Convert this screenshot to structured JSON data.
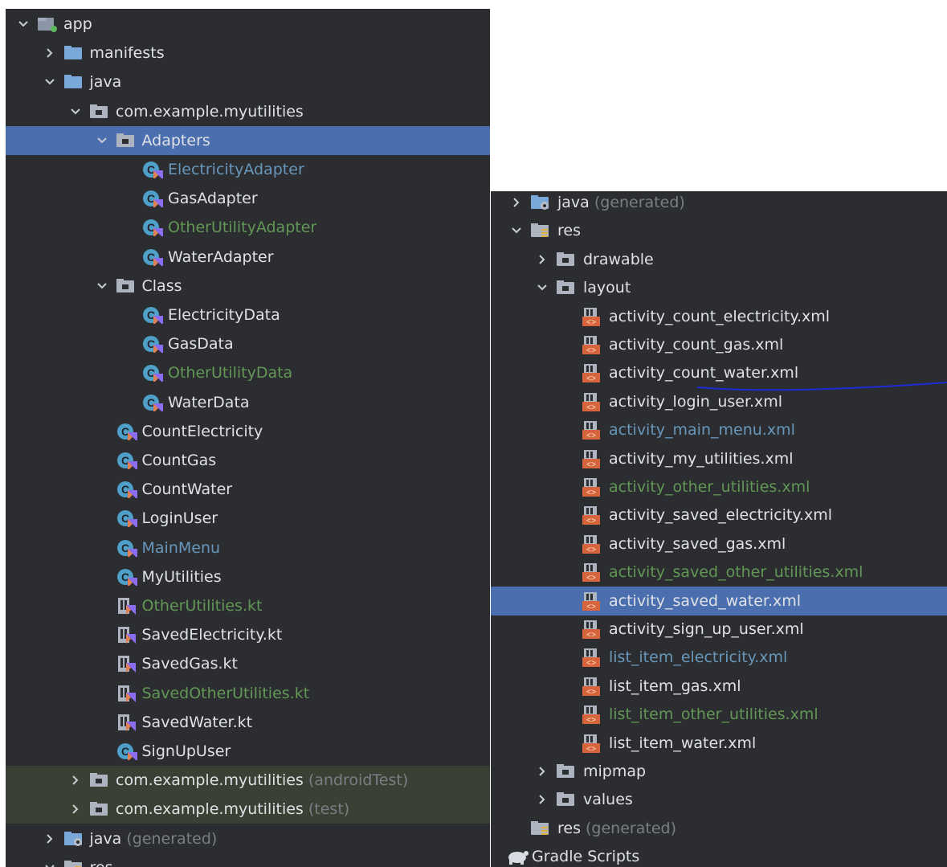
{
  "left_tree": [
    {
      "depth": 0,
      "arrow": "down",
      "icon": "module",
      "label": "app",
      "color": "default"
    },
    {
      "depth": 1,
      "arrow": "right",
      "icon": "folder",
      "label": "manifests",
      "color": "default"
    },
    {
      "depth": 1,
      "arrow": "down",
      "icon": "folder",
      "label": "java",
      "color": "default"
    },
    {
      "depth": 2,
      "arrow": "down",
      "icon": "package",
      "label": "com.example.myutilities",
      "color": "default"
    },
    {
      "depth": 3,
      "arrow": "down",
      "icon": "package",
      "label": "Adapters",
      "color": "default",
      "selected": true
    },
    {
      "depth": 4,
      "icon": "kotlin-class",
      "label": "ElectricityAdapter",
      "color": "blue"
    },
    {
      "depth": 4,
      "icon": "kotlin-class",
      "label": "GasAdapter",
      "color": "default"
    },
    {
      "depth": 4,
      "icon": "kotlin-class",
      "label": "OtherUtilityAdapter",
      "color": "green"
    },
    {
      "depth": 4,
      "icon": "kotlin-class",
      "label": "WaterAdapter",
      "color": "default"
    },
    {
      "depth": 3,
      "arrow": "down",
      "icon": "package",
      "label": "Class",
      "color": "default"
    },
    {
      "depth": 4,
      "icon": "kotlin-class",
      "label": "ElectricityData",
      "color": "default"
    },
    {
      "depth": 4,
      "icon": "kotlin-class",
      "label": "GasData",
      "color": "default"
    },
    {
      "depth": 4,
      "icon": "kotlin-class",
      "label": "OtherUtilityData",
      "color": "green"
    },
    {
      "depth": 4,
      "icon": "kotlin-class",
      "label": "WaterData",
      "color": "default"
    },
    {
      "depth": 3,
      "icon": "kotlin-class",
      "label": "CountElectricity",
      "color": "default"
    },
    {
      "depth": 3,
      "icon": "kotlin-class",
      "label": "CountGas",
      "color": "default"
    },
    {
      "depth": 3,
      "icon": "kotlin-class",
      "label": "CountWater",
      "color": "default"
    },
    {
      "depth": 3,
      "icon": "kotlin-class",
      "label": "LoginUser",
      "color": "default"
    },
    {
      "depth": 3,
      "icon": "kotlin-class",
      "label": "MainMenu",
      "color": "blue"
    },
    {
      "depth": 3,
      "icon": "kotlin-class",
      "label": "MyUtilities",
      "color": "default"
    },
    {
      "depth": 3,
      "icon": "kotlin-file",
      "label": "OtherUtilities.kt",
      "color": "green"
    },
    {
      "depth": 3,
      "icon": "kotlin-file",
      "label": "SavedElectricity.kt",
      "color": "default"
    },
    {
      "depth": 3,
      "icon": "kotlin-file",
      "label": "SavedGas.kt",
      "color": "default"
    },
    {
      "depth": 3,
      "icon": "kotlin-file",
      "label": "SavedOtherUtilities.kt",
      "color": "green"
    },
    {
      "depth": 3,
      "icon": "kotlin-file",
      "label": "SavedWater.kt",
      "color": "default"
    },
    {
      "depth": 3,
      "icon": "kotlin-class",
      "label": "SignUpUser",
      "color": "default"
    },
    {
      "depth": 2,
      "arrow": "right",
      "icon": "package",
      "label": "com.example.myutilities",
      "suffix": "(androidTest)",
      "color": "default",
      "band": true
    },
    {
      "depth": 2,
      "arrow": "right",
      "icon": "package",
      "label": "com.example.myutilities",
      "suffix": "(test)",
      "color": "default",
      "band": true
    },
    {
      "depth": 1,
      "arrow": "right",
      "icon": "generated-folder",
      "label": "java",
      "suffix": "(generated)",
      "color": "default"
    },
    {
      "depth": 1,
      "arrow": "down",
      "icon": "res-folder",
      "label": "res",
      "color": "default"
    }
  ],
  "right_tree": [
    {
      "depth": 0,
      "arrow": "right",
      "icon": "generated-folder",
      "label": "java",
      "suffix": "(generated)",
      "color": "default"
    },
    {
      "depth": 0,
      "arrow": "down",
      "icon": "res-folder",
      "label": "res",
      "color": "default"
    },
    {
      "depth": 1,
      "arrow": "right",
      "icon": "package",
      "label": "drawable",
      "color": "default"
    },
    {
      "depth": 1,
      "arrow": "down",
      "icon": "package",
      "label": "layout",
      "color": "default"
    },
    {
      "depth": 2,
      "icon": "layout-xml",
      "label": "activity_count_electricity.xml",
      "color": "default"
    },
    {
      "depth": 2,
      "icon": "layout-xml",
      "label": "activity_count_gas.xml",
      "color": "default"
    },
    {
      "depth": 2,
      "icon": "layout-xml",
      "label": "activity_count_water.xml",
      "color": "default"
    },
    {
      "depth": 2,
      "icon": "layout-xml",
      "label": "activity_login_user.xml",
      "color": "default"
    },
    {
      "depth": 2,
      "icon": "layout-xml",
      "label": "activity_main_menu.xml",
      "color": "blue"
    },
    {
      "depth": 2,
      "icon": "layout-xml",
      "label": "activity_my_utilities.xml",
      "color": "default"
    },
    {
      "depth": 2,
      "icon": "layout-xml",
      "label": "activity_other_utilities.xml",
      "color": "green"
    },
    {
      "depth": 2,
      "icon": "layout-xml",
      "label": "activity_saved_electricity.xml",
      "color": "default"
    },
    {
      "depth": 2,
      "icon": "layout-xml",
      "label": "activity_saved_gas.xml",
      "color": "default"
    },
    {
      "depth": 2,
      "icon": "layout-xml",
      "label": "activity_saved_other_utilities.xml",
      "color": "green"
    },
    {
      "depth": 2,
      "icon": "layout-xml",
      "label": "activity_saved_water.xml",
      "color": "default",
      "selected": true
    },
    {
      "depth": 2,
      "icon": "layout-xml",
      "label": "activity_sign_up_user.xml",
      "color": "default"
    },
    {
      "depth": 2,
      "icon": "layout-xml",
      "label": "list_item_electricity.xml",
      "color": "blue"
    },
    {
      "depth": 2,
      "icon": "layout-xml",
      "label": "list_item_gas.xml",
      "color": "default"
    },
    {
      "depth": 2,
      "icon": "layout-xml",
      "label": "list_item_other_utilities.xml",
      "color": "green"
    },
    {
      "depth": 2,
      "icon": "layout-xml",
      "label": "list_item_water.xml",
      "color": "default"
    },
    {
      "depth": 1,
      "arrow": "right",
      "icon": "package",
      "label": "mipmap",
      "color": "default"
    },
    {
      "depth": 1,
      "arrow": "right",
      "icon": "package",
      "label": "values",
      "color": "default"
    },
    {
      "depth": 0,
      "icon": "res-folder",
      "label": "res",
      "suffix": "(generated)",
      "color": "default"
    },
    {
      "depth": -1,
      "icon": "gradle",
      "label": "Gradle Scripts",
      "color": "default"
    }
  ],
  "colors": {
    "panel_bg": "#2b2d30",
    "selected_bg": "#4b6eaf",
    "test_band_bg": "#3a4033",
    "text_default": "#dfe1e5",
    "text_modified": "#6897bb",
    "text_added": "#629755",
    "text_suffix": "#7a7e85",
    "annotation_stroke": "#1f2bd6"
  }
}
